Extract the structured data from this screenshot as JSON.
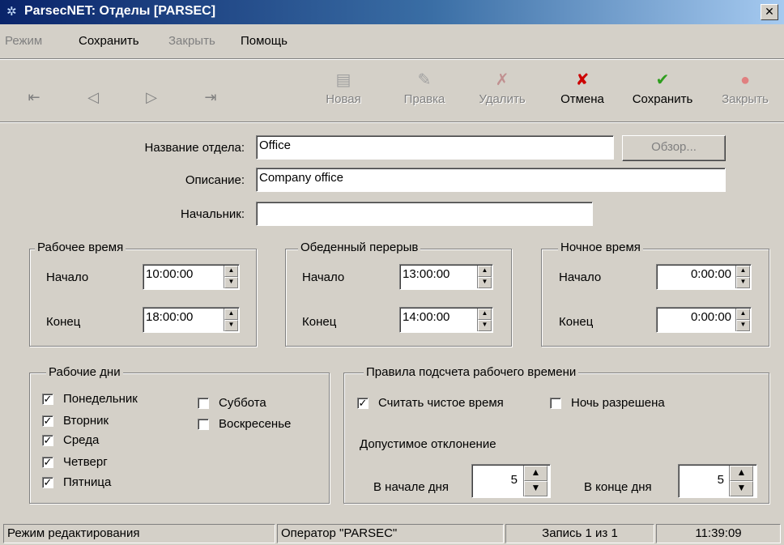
{
  "window": {
    "title": "ParsecNET: Отделы [PARSEC]"
  },
  "menu": [
    "Режим",
    "Сохранить",
    "Закрыть",
    "Помощь"
  ],
  "toolbar": {
    "nav": {
      "first": "⇤",
      "prev": "◁",
      "next": "▷",
      "last": "⇥"
    },
    "new": "Новая",
    "edit": "Правка",
    "delete": "Удалить",
    "cancel": "Отмена",
    "save": "Сохранить",
    "close": "Закрыть"
  },
  "form": {
    "name_label": "Название отдела:",
    "name_value": "Office",
    "browse": "Обзор...",
    "desc_label": "Описание:",
    "desc_value": "Company office",
    "head_label": "Начальник:",
    "head_value": ""
  },
  "work_time": {
    "title": "Рабочее время",
    "start_label": "Начало",
    "start": "10:00:00",
    "end_label": "Конец",
    "end": "18:00:00"
  },
  "lunch": {
    "title": "Обеденный перерыв",
    "start_label": "Начало",
    "start": "13:00:00",
    "end_label": "Конец",
    "end": "14:00:00"
  },
  "night": {
    "title": "Ночное время",
    "start_label": "Начало",
    "start": "0:00:00",
    "end_label": "Конец",
    "end": "0:00:00"
  },
  "workdays": {
    "title": "Рабочие дни",
    "days": [
      {
        "label": "Понедельник",
        "checked": true
      },
      {
        "label": "Вторник",
        "checked": true
      },
      {
        "label": "Среда",
        "checked": true
      },
      {
        "label": "Четверг",
        "checked": true
      },
      {
        "label": "Пятница",
        "checked": true
      },
      {
        "label": "Суббота",
        "checked": false
      },
      {
        "label": "Воскресенье",
        "checked": false
      }
    ]
  },
  "rules": {
    "title": "Правила подсчета рабочего времени",
    "net_time": "Считать чистое время",
    "net_time_checked": true,
    "night_allowed": "Ночь разрешена",
    "night_allowed_checked": false,
    "deviation": "Допустимое отклонение",
    "day_start_label": "В начале дня",
    "day_start": "5",
    "day_end_label": "В конце дня",
    "day_end": "5"
  },
  "status": {
    "mode": "Режим редактирования",
    "operator": "Оператор \"PARSEC\"",
    "record": "Запись 1 из 1",
    "time": "11:39:09"
  },
  "colors": {
    "title_start": "#0a246a",
    "title_end": "#a6caf0",
    "face": "#d4d0c8",
    "cancel_icon": "#cc0000",
    "save_icon": "#2e9e1e"
  }
}
